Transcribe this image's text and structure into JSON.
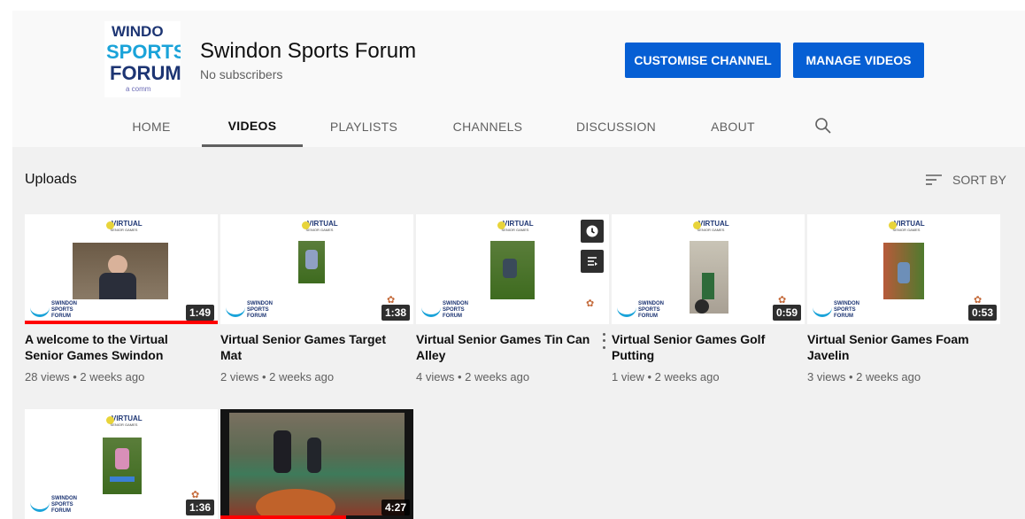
{
  "channel": {
    "logo": {
      "line1": "WINDO",
      "line2": "SPORTS",
      "line3": "FORUM",
      "line4": "a comm"
    },
    "name": "Swindon Sports Forum",
    "subscribers": "No subscribers"
  },
  "buttons": {
    "customise": "CUSTOMISE CHANNEL",
    "manage": "MANAGE VIDEOS"
  },
  "tabs": [
    {
      "label": "HOME"
    },
    {
      "label": "VIDEOS",
      "active": true
    },
    {
      "label": "PLAYLISTS"
    },
    {
      "label": "CHANNELS"
    },
    {
      "label": "DISCUSSION"
    },
    {
      "label": "ABOUT"
    }
  ],
  "section": {
    "title": "Uploads",
    "sort_label": "SORT BY"
  },
  "thumb_branding": {
    "vsg_title": "VIRTUAL",
    "vsg_sub": "SENIOR GAMES",
    "ssf_text": "SWINDON SPORTS FORUM"
  },
  "videos": [
    {
      "title": "A welcome to the Virtual Senior Games Swindon",
      "meta": "28 views • 2 weeks ago",
      "duration": "1:49",
      "watched": 1.0
    },
    {
      "title": "Virtual Senior Games Target Mat",
      "meta": "2 views • 2 weeks ago",
      "duration": "1:38"
    },
    {
      "title": "Virtual Senior Games Tin Can Alley",
      "meta": "4 views • 2 weeks ago",
      "duration": ""
    },
    {
      "title": "Virtual Senior Games Golf Putting",
      "meta": "1 view • 2 weeks ago",
      "duration": "0:59"
    },
    {
      "title": "Virtual Senior Games Foam Javelin",
      "meta": "3 views • 2 weeks ago",
      "duration": "0:53"
    },
    {
      "title": "",
      "meta": "",
      "duration": "1:36"
    },
    {
      "title": "",
      "meta": "",
      "duration": "4:27",
      "watched": 0.65
    }
  ],
  "colors": {
    "accent": "#065fd4",
    "progress": "#ff0000",
    "background": "#f1f1f1"
  }
}
